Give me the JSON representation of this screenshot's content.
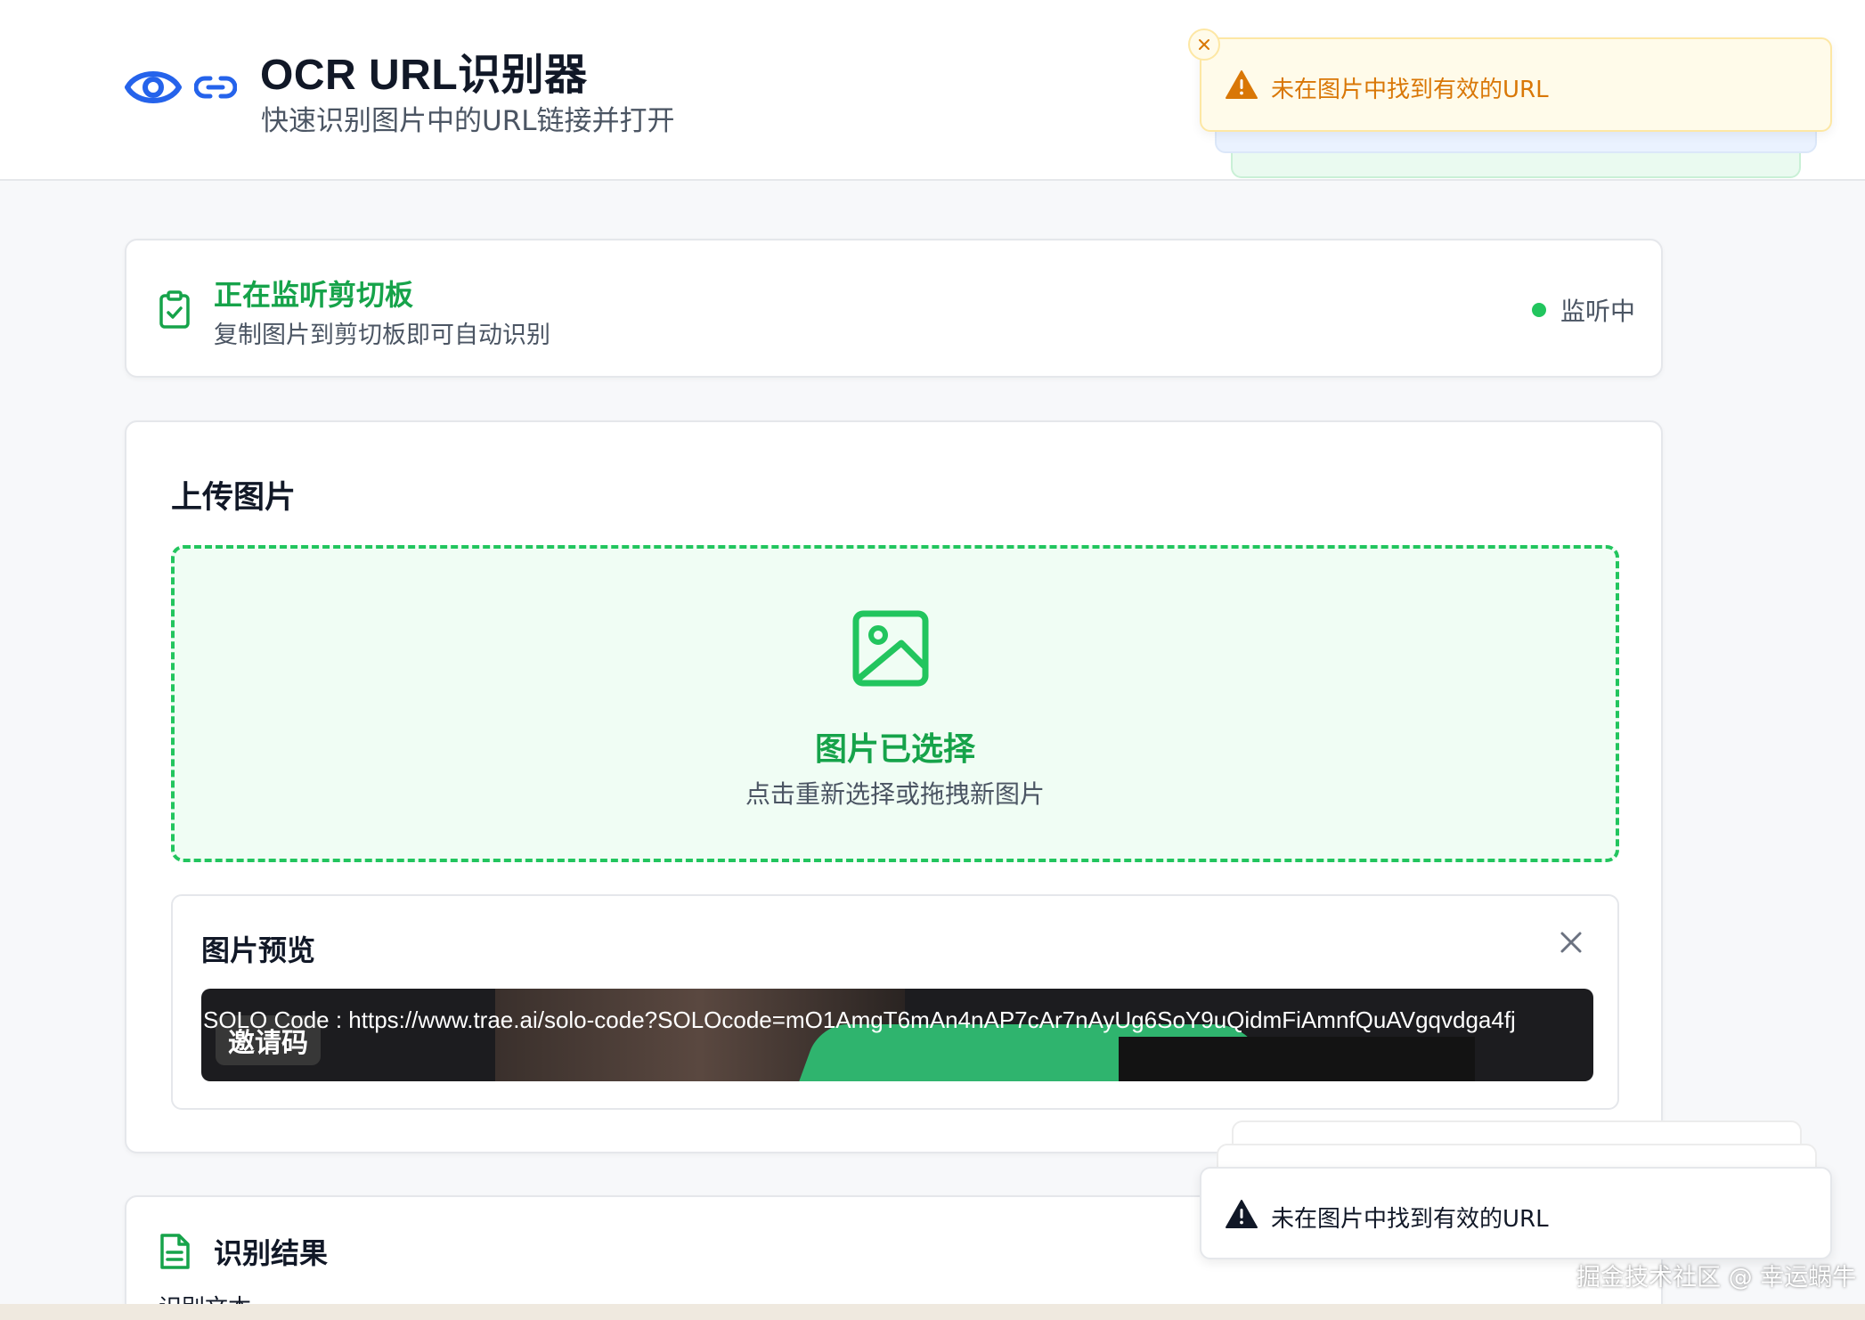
{
  "header": {
    "title": "OCR URL识别器",
    "subtitle": "快速识别图片中的URL链接并打开",
    "icons": [
      "eye-icon",
      "link-icon"
    ]
  },
  "monitor": {
    "title": "正在监听剪切板",
    "description": "复制图片到剪切板即可自动识别",
    "status": "监听中",
    "status_color": "#22c55e"
  },
  "upload": {
    "heading": "上传图片",
    "drop_title": "图片已选择",
    "drop_hint": "点击重新选择或拖拽新图片"
  },
  "preview": {
    "title": "图片预览",
    "image_badge": "邀请码",
    "image_url_text": "SOLO Code : https://www.trae.ai/solo-code?SOLOcode=mO1AmgT6mAn4nAP7cAr7nAyUg6SoY9uQidmFiAmnfQuAVgqvdga4fj"
  },
  "result": {
    "title": "识别结果",
    "subtitle": "识别文本"
  },
  "toasts": {
    "warning_message": "未在图片中找到有效的URL",
    "plain_message": "未在图片中找到有效的URL"
  },
  "watermark": "掘金技术社区 @ 幸运蜗牛",
  "colors": {
    "accent_green": "#16a34a",
    "accent_blue": "#2563eb",
    "warning": "#d97706"
  }
}
